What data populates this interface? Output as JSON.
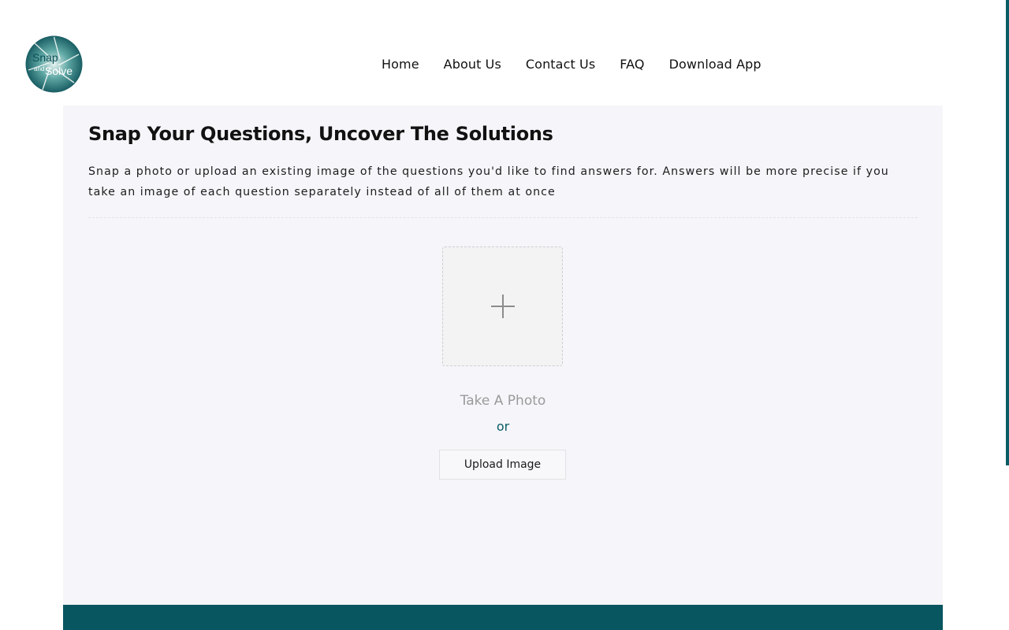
{
  "logo": {
    "line1": "Snap",
    "line2": "and",
    "line3": "Solve"
  },
  "nav": {
    "items": [
      {
        "label": "Home"
      },
      {
        "label": "About Us"
      },
      {
        "label": "Contact Us"
      },
      {
        "label": "FAQ"
      },
      {
        "label": "Download App"
      }
    ]
  },
  "main": {
    "title": "Snap Your Questions, Uncover The Solutions",
    "description": "Snap a photo or upload an existing image of the questions you'd like to find answers for. Answers will be more precise if you take an image of each question separately instead of all of them at once",
    "take_photo_label": "Take A Photo",
    "or_label": "or",
    "upload_button_label": "Upload Image"
  },
  "colors": {
    "brand_teal": "#0a5c66",
    "panel_bg": "#f6f5f9"
  },
  "icons": {
    "add": "plus-icon"
  }
}
